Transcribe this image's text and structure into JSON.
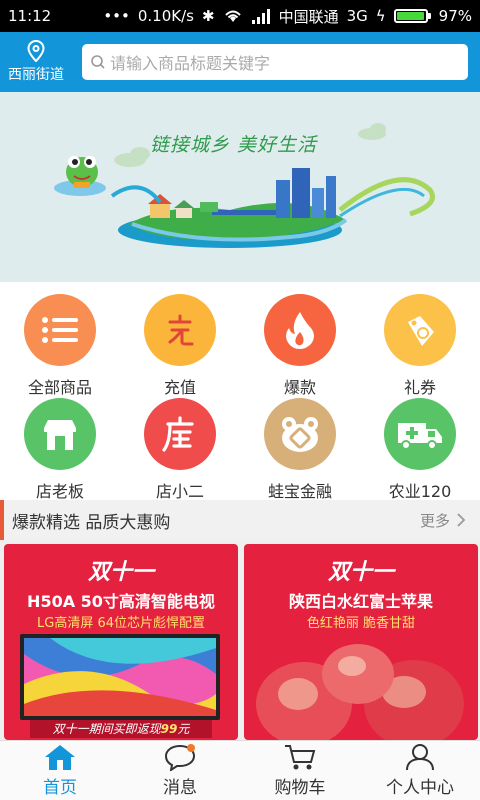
{
  "status": {
    "time": "11:12",
    "speed": "0.10K/s",
    "carrier": "中国联通",
    "network": "3G",
    "battery": "97%",
    "battery_level": 0.97
  },
  "header": {
    "location": "西丽街道",
    "search_placeholder": "请输入商品标题关键字"
  },
  "banner": {
    "slogan": "链接城乡  美好生活"
  },
  "categories": [
    {
      "label": "全部商品",
      "icon": "list-icon",
      "color": "#f98e52"
    },
    {
      "label": "充值",
      "icon": "recharge-icon",
      "color": "#fbb53b"
    },
    {
      "label": "爆款",
      "icon": "flame-icon",
      "color": "#f6653f"
    },
    {
      "label": "礼券",
      "icon": "coupon-icon",
      "color": "#fbc148"
    },
    {
      "label": "店老板",
      "icon": "store-icon",
      "color": "#58c467"
    },
    {
      "label": "店小二",
      "icon": "shop-assistant-icon",
      "color": "#f04c4c"
    },
    {
      "label": "蛙宝金融",
      "icon": "frog-finance-icon",
      "color": "#d7b079"
    },
    {
      "label": "农业120",
      "icon": "ambulance-icon",
      "color": "#58c467"
    }
  ],
  "section": {
    "title": "爆款精选 品质大惠购",
    "more": "更多"
  },
  "products": [
    {
      "brand": "双十一",
      "title": "H50A 50寸高清智能电视",
      "sub": "LG高清屏   64位芯片彪悍配置",
      "footer_text": "双十一期间买即返现",
      "footer_value": "99",
      "footer_unit": "元"
    },
    {
      "brand": "双十一",
      "title": "陕西白水红富士苹果",
      "sub": "色红艳丽    脆香甘甜"
    }
  ],
  "tabs": [
    {
      "label": "首页",
      "icon": "home-icon",
      "active": true
    },
    {
      "label": "消息",
      "icon": "message-icon",
      "active": false
    },
    {
      "label": "购物车",
      "icon": "cart-icon",
      "active": false
    },
    {
      "label": "个人中心",
      "icon": "user-icon",
      "active": false
    }
  ],
  "colors": {
    "accent": "#1396d9",
    "promo": "#e4213f",
    "section_marker": "#e85a3a"
  }
}
